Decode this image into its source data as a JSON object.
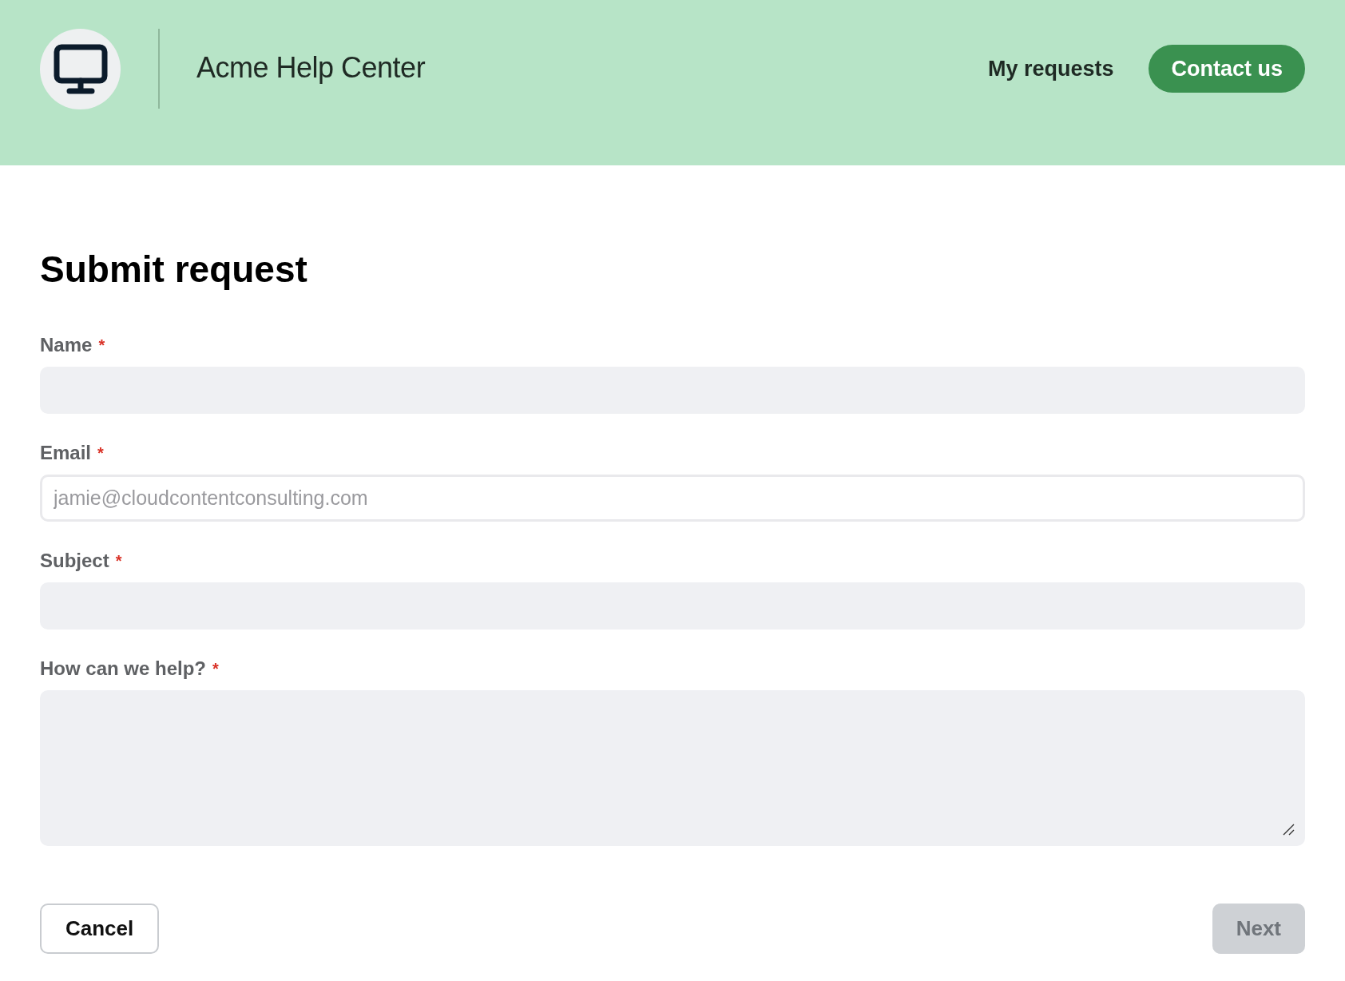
{
  "header": {
    "title": "Acme Help Center",
    "nav_link": "My requests",
    "cta_button": "Contact us"
  },
  "page": {
    "heading": "Submit request"
  },
  "fields": [
    {
      "label": "Name",
      "required_mark": "*",
      "kind": "input",
      "focused": false
    },
    {
      "label": "Email",
      "required_mark": "*",
      "kind": "input",
      "focused": true,
      "placeholder": "jamie@cloudcontentconsulting.com"
    },
    {
      "label": "Subject",
      "required_mark": "*",
      "kind": "input",
      "focused": false
    },
    {
      "label": "How can we help?",
      "required_mark": "*",
      "kind": "textarea",
      "focused": false
    }
  ],
  "actions": [
    {
      "label": "Cancel",
      "disabled": false
    },
    {
      "label": "Next",
      "disabled": true
    }
  ]
}
